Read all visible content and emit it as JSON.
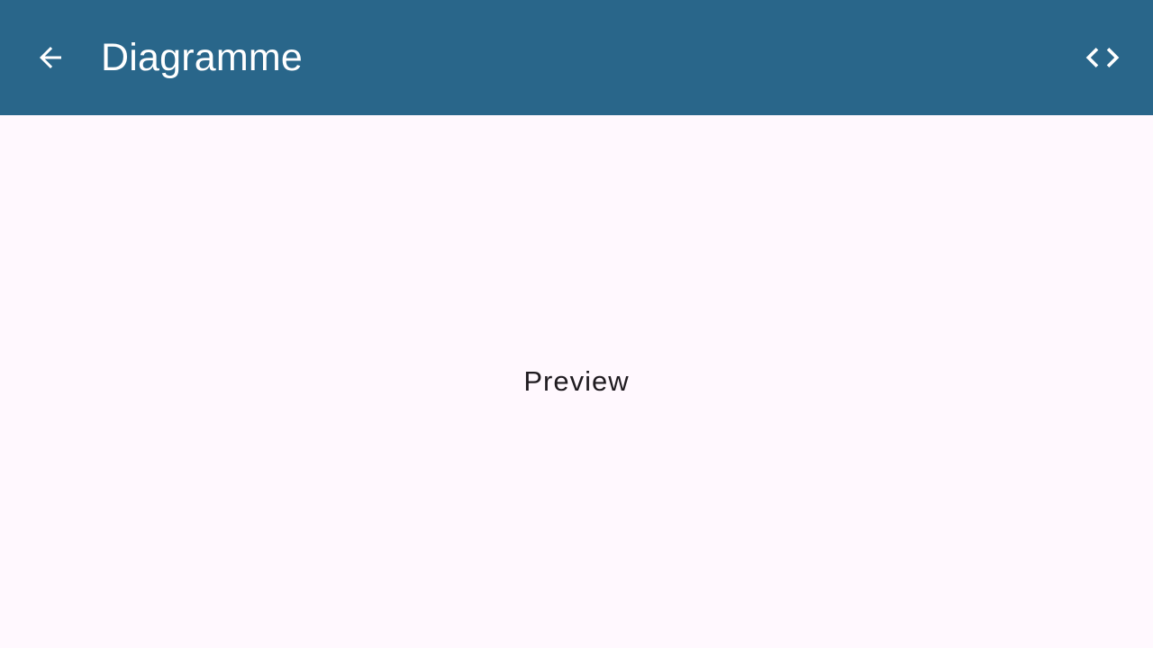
{
  "app_bar": {
    "title": "Diagramme",
    "background_color": "#29668A",
    "foreground_color": "#FFFFFF",
    "back_icon": "arrow-back-icon",
    "action_icon": "code-icon"
  },
  "content": {
    "label": "Preview",
    "background_color": "#FFF8FE",
    "text_color": "#1F1B20"
  }
}
